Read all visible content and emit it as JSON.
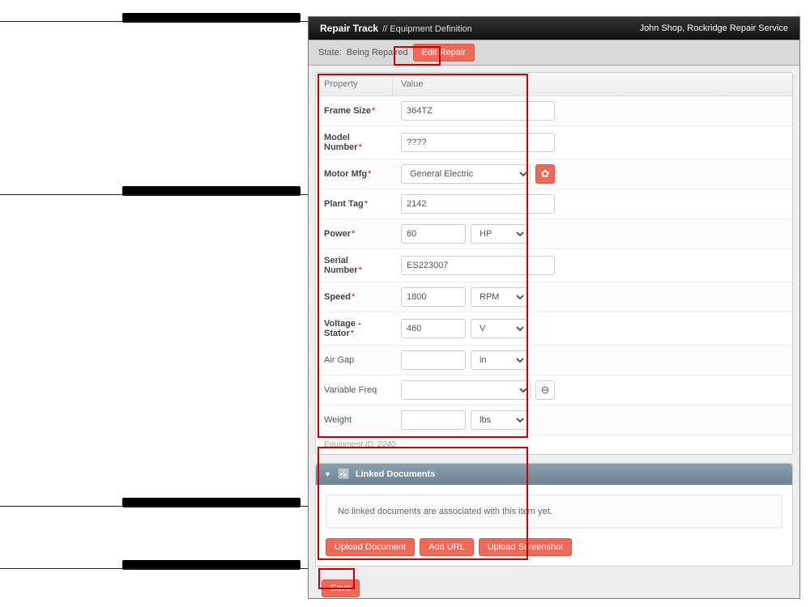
{
  "header": {
    "app_title": "Repair Track",
    "crumb": "// Equipment Definition",
    "user": "John Shop, Rockridge Repair Service"
  },
  "toolbar": {
    "state_label": "State:",
    "state_value": "Being Repaired",
    "edit_btn": "Edit Repair"
  },
  "columns": {
    "property": "Property",
    "value": "Value"
  },
  "props": {
    "frame_size": {
      "label": "Frame Size",
      "required": true,
      "value": "364TZ"
    },
    "model_number": {
      "label": "Model Number",
      "required": true,
      "value": "????"
    },
    "motor_mfg": {
      "label": "Motor Mfg",
      "required": true,
      "value": "General Electric"
    },
    "plant_tag": {
      "label": "Plant Tag",
      "required": true,
      "value": "2142"
    },
    "power": {
      "label": "Power",
      "required": true,
      "value": "60",
      "unit": "HP"
    },
    "serial_number": {
      "label": "Serial Number",
      "required": true,
      "value": "ES223007"
    },
    "speed": {
      "label": "Speed",
      "required": true,
      "value": "1800",
      "unit": "RPM"
    },
    "voltage_stator": {
      "label": "Voltage - Stator",
      "required": true,
      "value": "460",
      "unit": "V"
    },
    "air_gap": {
      "label": "Air Gap",
      "required": false,
      "value": "",
      "unit": "in"
    },
    "variable_freq": {
      "label": "Variable Freq",
      "required": false,
      "value": ""
    },
    "weight": {
      "label": "Weight",
      "required": false,
      "value": "",
      "unit": "lbs"
    }
  },
  "equipment_id": "Equipment ID: 2240",
  "docs": {
    "title": "Linked Documents",
    "empty": "No linked documents are associated with this item yet.",
    "upload_doc": "Upload Document",
    "add_url": "Add URL",
    "upload_shot": "Upload Screenshot"
  },
  "save": "Save"
}
